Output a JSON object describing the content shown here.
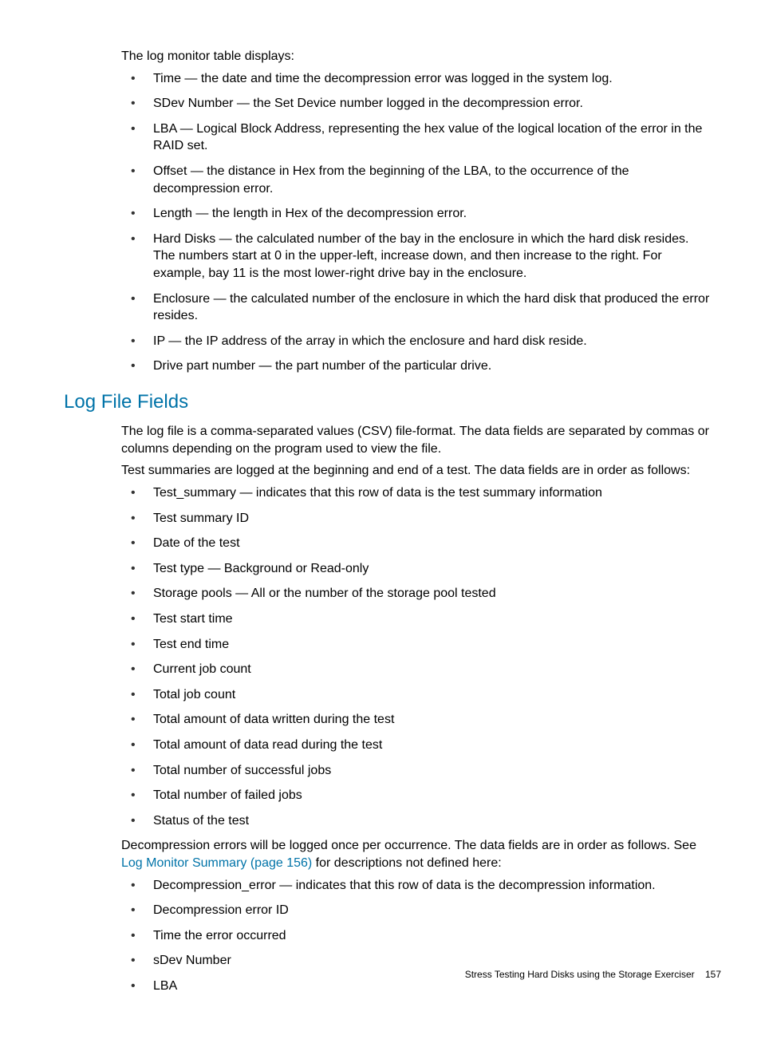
{
  "intro1": "The log monitor table displays:",
  "list1": [
    "Time — the date and time the decompression error was logged in the system log.",
    "SDev Number — the Set Device number logged in the decompression error.",
    "LBA — Logical Block Address, representing the hex value of the logical location of the error in the RAID set.",
    "Offset — the distance in Hex from the beginning of the LBA, to the occurrence of the decompression error.",
    "Length — the length in Hex of the decompression error.",
    "Hard Disks — the calculated number of the bay in the enclosure in which the hard disk resides. The numbers start at 0 in the upper-left, increase down, and then increase to the right. For example, bay 11 is the most lower-right drive bay in the enclosure.",
    "Enclosure — the calculated number of the enclosure in which the hard disk that produced the error resides.",
    "IP — the IP address of the array in which the enclosure and hard disk reside.",
    "Drive part number — the part number of the particular drive."
  ],
  "heading": "Log File Fields",
  "para2": "The log file is a comma-separated values (CSV) file-format. The data fields are separated by commas or columns depending on the program used to view the file.",
  "para3": "Test summaries are logged at the beginning and end of a test. The data fields are in order as follows:",
  "list2": [
    "Test_summary — indicates that this row of data is the test summary information",
    "Test summary ID",
    "Date of the test",
    "Test type — Background or Read-only",
    "Storage pools — All or the number of the storage pool tested",
    "Test start time",
    "Test end time",
    "Current job count",
    "Total job count",
    "Total amount of data written during the test",
    "Total amount of data read during the test",
    "Total number of successful jobs",
    "Total number of failed jobs",
    "Status of the test"
  ],
  "para4_pre": "Decompression errors will be logged once per occurrence. The data fields are in order as follows. See ",
  "para4_link": "Log Monitor Summary (page 156)",
  "para4_post": " for descriptions not defined here:",
  "list3": [
    "Decompression_error — indicates that this row of data is the decompression information.",
    "Decompression error ID",
    "Time the error occurred",
    "sDev Number",
    "LBA"
  ],
  "footer_title": "Stress Testing Hard Disks using the Storage Exerciser",
  "footer_page": "157"
}
